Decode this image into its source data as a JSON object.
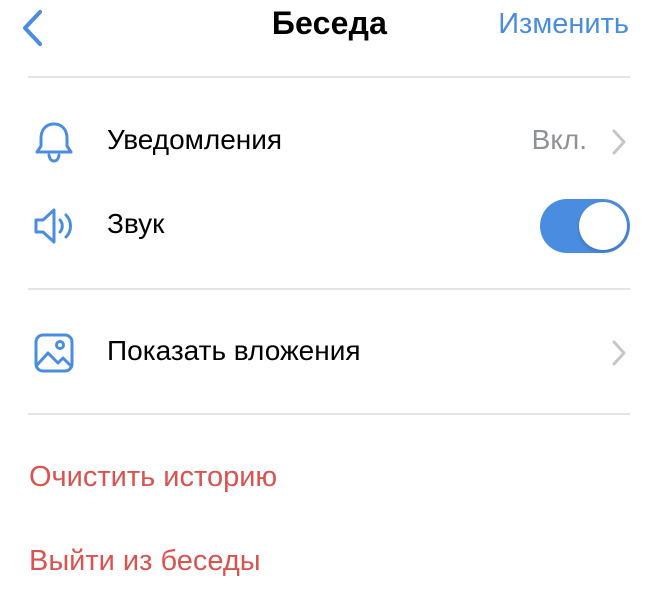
{
  "colors": {
    "accent": "#4a8de0",
    "destructive": "#d9534f",
    "secondary_text": "#8e9196",
    "divider": "#e3e4e6"
  },
  "nav": {
    "back_icon": "chevron-left-icon",
    "title": "Беседа",
    "edit_label": "Изменить"
  },
  "settings": {
    "notifications": {
      "icon": "bell-icon",
      "label": "Уведомления",
      "value": "Вкл."
    },
    "sound": {
      "icon": "speaker-icon",
      "label": "Звук",
      "enabled": true
    },
    "attachments": {
      "icon": "image-icon",
      "label": "Показать вложения"
    }
  },
  "actions": {
    "clear_history": "Очистить историю",
    "leave_chat": "Выйти из беседы"
  }
}
